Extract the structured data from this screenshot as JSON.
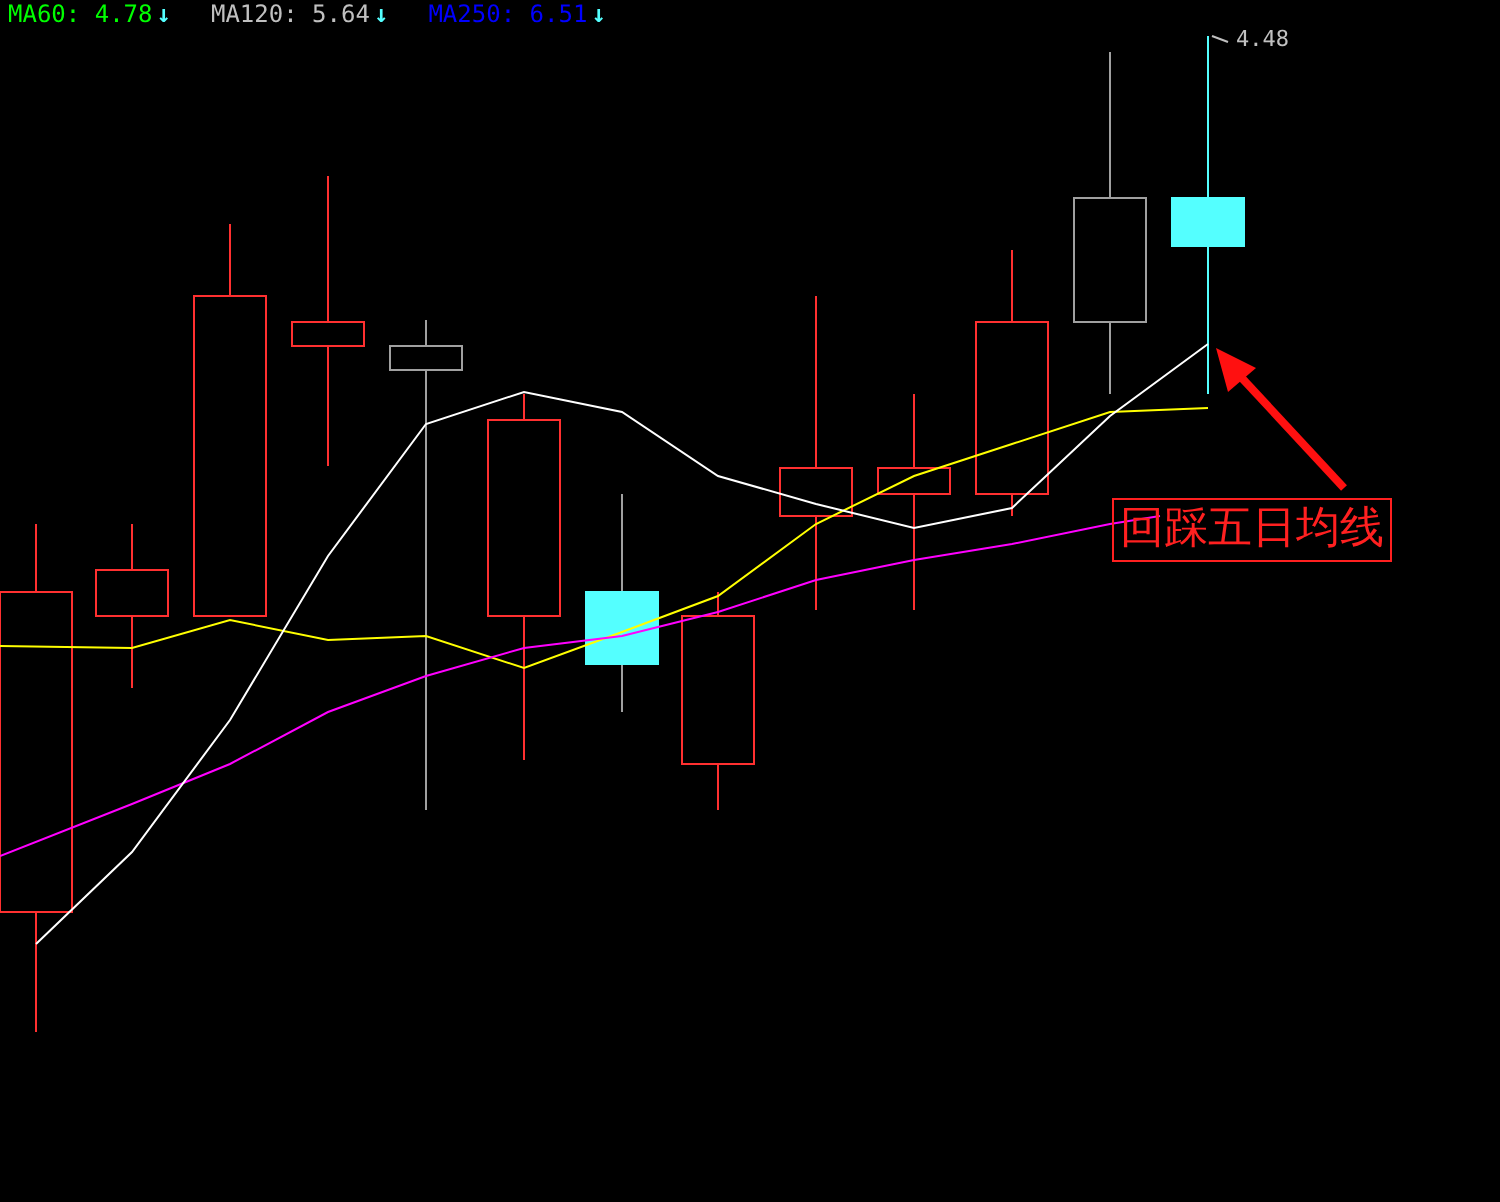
{
  "legend": [
    {
      "text": "MA60: 4.78",
      "arrow": "↓",
      "color": "#00ff00"
    },
    {
      "text": "MA120: 5.64",
      "arrow": "↓",
      "color": "#c0c0c0"
    },
    {
      "text": "MA250: 6.51",
      "arrow": "↓",
      "color": "#0000ff"
    }
  ],
  "high_label": "4.48",
  "callout": "回踩五日均线"
}
